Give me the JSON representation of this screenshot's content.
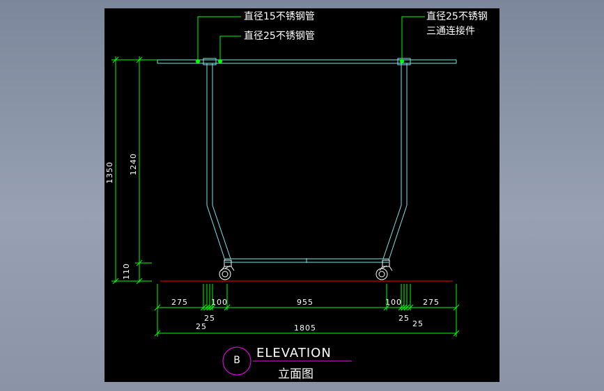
{
  "annotations": {
    "pipe15": "直径15不锈钢管",
    "pipe25": "直径25不锈钢管",
    "tee_line1": "直径25不锈钢",
    "tee_line2": "三通连接件"
  },
  "dimensions": {
    "horizontal": {
      "d275_left": "275",
      "d100_left": "100",
      "d955": "955",
      "d100_right": "100",
      "d275_right": "275",
      "d25_left_upper": "25",
      "d25_left_lower": "25",
      "d25_right_upper": "25",
      "d25_right_lower": "25",
      "d1805": "1805"
    },
    "vertical": {
      "d1350": "1350",
      "d1240": "1240",
      "d110": "110"
    }
  },
  "title_block": {
    "badge": "B",
    "title": "ELEVATION",
    "subtitle": "立面图"
  },
  "colors": {
    "background": "#000000",
    "pipe": "#7fe8e8",
    "dimension": "#00ff00",
    "leader": "#00ff00",
    "floor": "#ff0000",
    "title_circle": "#ff00ff",
    "title_underline": "#ff00ff",
    "text": "#ffffff"
  }
}
